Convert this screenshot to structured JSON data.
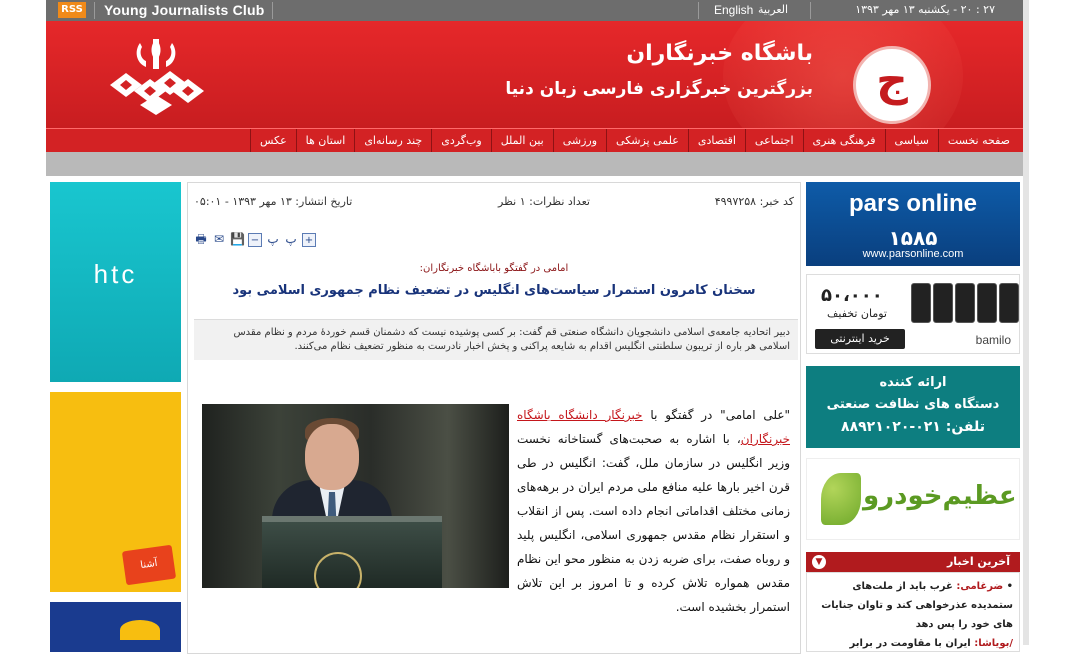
{
  "topbar": {
    "rss": "RSS",
    "site_en": "Young Journalists Club",
    "lang_en": "English",
    "lang_ar": "العربية",
    "datetime": "۲۷ : ۲۰ - یکشنبه ۱۳ مهر ۱۳۹۳"
  },
  "header": {
    "title": "باشگاه خبرنگاران",
    "slogan": "بزرگترین خبرگزاری فارسی زبان دنیا",
    "logo_glyph": "ج"
  },
  "nav": [
    "صفحه نخست",
    "سیاسی",
    "فرهنگی هنری",
    "اجتماعی",
    "اقتصادی",
    "علمی پزشکی",
    "ورزشی",
    "بین الملل",
    "وب‌گردی",
    "چند رسانه‌ای",
    "استان ها",
    "عکس"
  ],
  "ads_left": {
    "htc": "htc",
    "ashena": "آشنا Ashena"
  },
  "article": {
    "news_code": "کد خبر: ۴۹۹۷۲۵۸",
    "comments": "تعداد نظرات: ۱ نظر",
    "publish_date": "تاریخ انتشار: ۱۳ مهر ۱۳۹۳ - ۰۵:۰۱",
    "tools": [
      "+",
      "پ",
      "پ",
      "−"
    ],
    "subtitle": "امامی در گفتگو باباشگاه خبرنگاران:",
    "headline": "سخنان کامرون استمرار سیاست‌های انگلیس در تضعیف نظام جمهوری اسلامی بود",
    "lead": "دبیر اتحادیه جامعه‌ی اسلامی دانشجویان دانشگاه صنعتی قم گفت: بر کسی پوشیده نیست که دشمنان قسم خوردهٔ مردم و نظام مقدس اسلامی هر باره از تریبون سلطنتی انگلیس اقدام به شایعه پراکنی و پخش اخبار نادرست به منظور تضعیف نظام می‌کنند.",
    "body_pre": "\"علی امامی\" در گفتگو با ",
    "body_link": "خبرنگار دانشگاه باشگاه خبرنگاران",
    "body_post": "، با اشاره به صحبت‌های گستاخانه نخست وزیر انگلیس در سازمان ملل، گفت: انگلیس در طی قرن اخیر بارها علیه منافع ملی مردم ایران در برهه‌های زمانی مختلف اقداماتی انجام داده است. پس از انقلاب و استقرار نظام مقدس جمهوری اسلامی، انگلیس پلید و روباه صفت، برای ضربه زدن به منظور محو این نظام مقدس همواره تلاش کرده و تا امروز بر این تلاش استمرار بخشیده است."
  },
  "ads_right": {
    "pars_brand": "pars online",
    "pars_number": "۱۵۸۵",
    "pars_url": "www.parsonline.com",
    "phones_price": "۵۰،۰۰۰",
    "phones_off": "تومان تخفیف",
    "phones_buy": "خرید اینترنتی",
    "phones_brand": "bamilo",
    "clean_1": "ارائه کننده",
    "clean_2": "دستگاه های نظافت صنعتی",
    "clean_3": "تلفن: ۰۲۱-۸۸۹۲۱۰۲۰",
    "azim": "عظیم‌خودرو"
  },
  "latest_news": {
    "title": "آخرین اخبار",
    "items": [
      {
        "source": "ضرغامی:",
        "text": " غرب باید از ملت‌های ستمدیده عذرخواهی کند و تاوان جنایات های خود را پس دهد"
      },
      {
        "source": "/بویاشا:",
        "text": " ایران با مقاومت در برابر"
      }
    ]
  }
}
